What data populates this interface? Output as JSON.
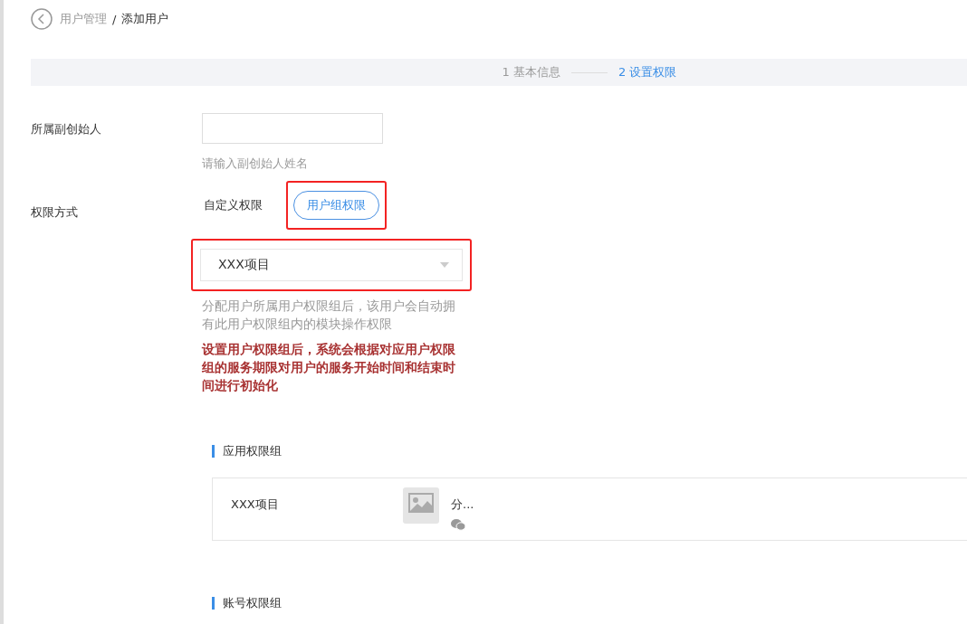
{
  "breadcrumb": {
    "parent": "用户管理",
    "separator": "/",
    "current": "添加用户"
  },
  "steps": [
    {
      "label": "1 基本信息",
      "selected": false
    },
    {
      "label": "2 设置权限",
      "selected": true
    }
  ],
  "founder_field": {
    "label": "所属副创始人",
    "hint": "请输入副创始人姓名"
  },
  "permission_mode": {
    "label": "权限方式",
    "options": [
      {
        "label": "自定义权限",
        "selected": false
      },
      {
        "label": "用户组权限",
        "selected": true
      }
    ]
  },
  "group_select": {
    "value": "XXX项目",
    "hint": "分配用户所属用户权限组后，该用户会自动拥有此用户权限组内的模块操作权限",
    "warning": "设置用户权限组后，系统会根据对应用户权限组的服务期限对用户的服务开始时间和结束时间进行初始化"
  },
  "sections": [
    {
      "title": "应用权限组",
      "items": [
        {
          "name": "XXX项目",
          "app_name": "分..."
        }
      ]
    },
    {
      "title": "账号权限组"
    }
  ]
}
